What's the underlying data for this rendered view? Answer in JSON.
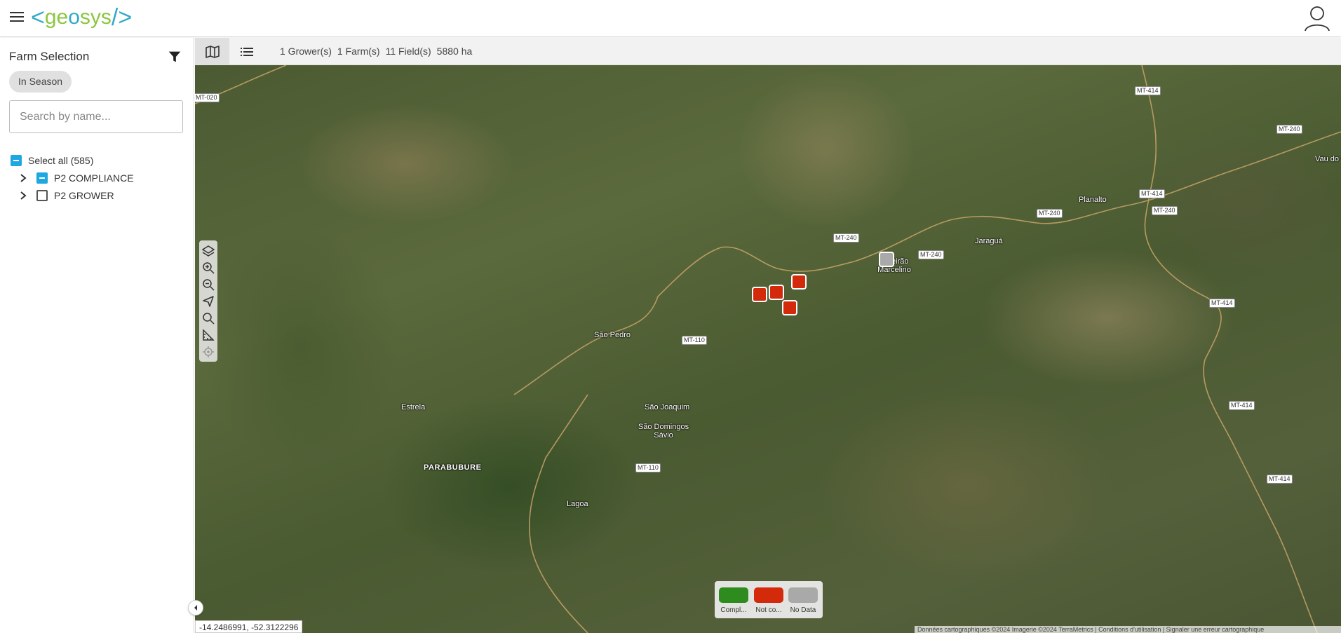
{
  "app": {
    "logo_text": "geosys",
    "brand_color": "#33a9c9",
    "accent_green": "#8cc63f"
  },
  "header": {
    "menu_icon": "menu-icon",
    "user_icon": "user-icon"
  },
  "sidebar": {
    "title": "Farm Selection",
    "filter_icon": "filter-icon",
    "season_chip": "In Season",
    "search_placeholder": "Search by name...",
    "select_all": "Select all (585)",
    "items": [
      {
        "label": "P2 COMPLIANCE",
        "state": "indeterminate"
      },
      {
        "label": "P2 GROWER",
        "state": "unchecked"
      }
    ]
  },
  "toolbar": {
    "summary": [
      "1 Grower(s)",
      "1 Farm(s)",
      "11 Field(s)",
      "5880 ha"
    ]
  },
  "map": {
    "places": [
      "São Pedro",
      "Estrela",
      "São Joaquim",
      "PARABUBURE",
      "São Domingos Sávio",
      "Lagoa",
      "Jaraguá",
      "Planalto",
      "Ribeirão Marcelino",
      "Vau do Gaucho"
    ],
    "roads": [
      "MT-020",
      "MT-414",
      "MT-240",
      "MT-110"
    ],
    "markers": [
      {
        "status": "Not compliant",
        "color": "#d42a0c"
      },
      {
        "status": "No Data",
        "color": "#a9a9a9"
      }
    ],
    "coordinates": "-14.2486991, -52.3122296",
    "attribution": "Données cartographiques ©2024 Imagerie ©2024 TerraMetrics | Conditions d'utilisation | Signaler une erreur cartographique"
  },
  "legend": [
    {
      "label": "Compliant",
      "display": "Compl...",
      "color": "#2e8b1e"
    },
    {
      "label": "Not compliant",
      "display": "Not co...",
      "color": "#d42a0c"
    },
    {
      "label": "No Data",
      "display": "No Data",
      "color": "#a9a9a9"
    }
  ]
}
